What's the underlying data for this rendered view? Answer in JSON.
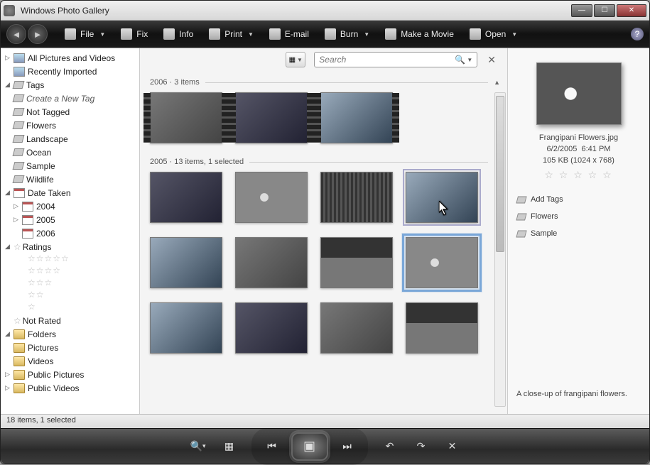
{
  "titlebar": {
    "title": "Windows Photo Gallery"
  },
  "toolbar": {
    "file": "File",
    "fix": "Fix",
    "info": "Info",
    "print": "Print",
    "email": "E-mail",
    "burn": "Burn",
    "movie": "Make a Movie",
    "open": "Open"
  },
  "sidebar": {
    "all": "All Pictures and Videos",
    "recent": "Recently Imported",
    "tags_label": "Tags",
    "tags": {
      "create": "Create a New Tag",
      "items": [
        "Not Tagged",
        "Flowers",
        "Landscape",
        "Ocean",
        "Sample",
        "Wildlife"
      ]
    },
    "date_label": "Date Taken",
    "dates": [
      "2004",
      "2005",
      "2006"
    ],
    "ratings_label": "Ratings",
    "not_rated": "Not Rated",
    "folders_label": "Folders",
    "folders": [
      "Pictures",
      "Videos",
      "Public Pictures",
      "Public Videos"
    ]
  },
  "search": {
    "placeholder": "Search"
  },
  "groups": [
    {
      "title": "2006",
      "subtitle": "3 items"
    },
    {
      "title": "2005",
      "subtitle": "13 items, 1 selected"
    }
  ],
  "info": {
    "filename": "Frangipani Flowers.jpg",
    "date": "6/2/2005",
    "time": "6:41 PM",
    "size": "105 KB (1024 x 768)",
    "add_tags": "Add Tags",
    "tags": [
      "Flowers",
      "Sample"
    ],
    "caption": "A close-up of frangipani flowers."
  },
  "status": "18 items, 1 selected"
}
